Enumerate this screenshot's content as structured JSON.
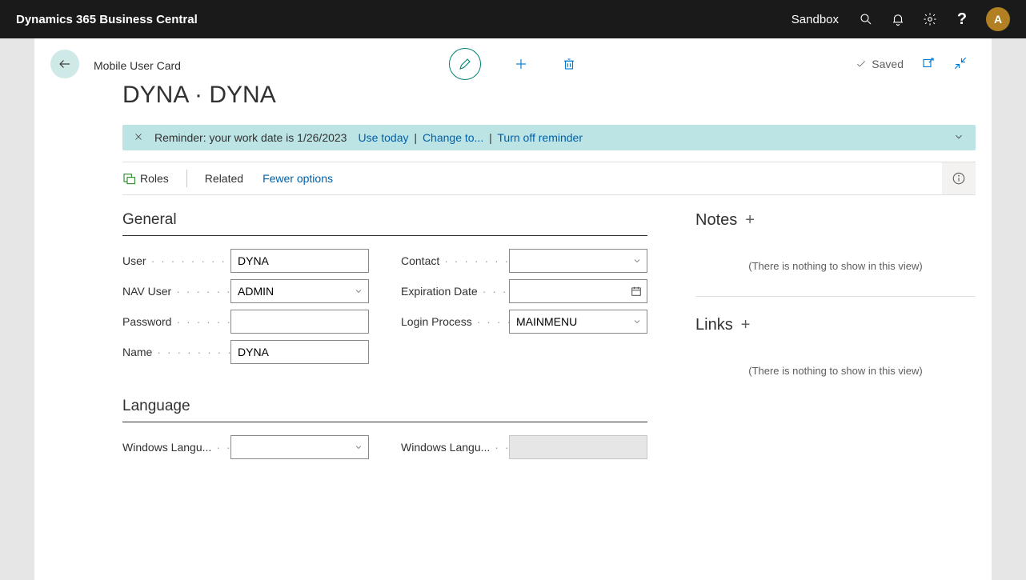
{
  "top": {
    "app_title": "Dynamics 365 Business Central",
    "env_label": "Sandbox",
    "avatar_letter": "A",
    "help_symbol": "?"
  },
  "header": {
    "page_label": "Mobile User Card",
    "title": "DYNA · DYNA",
    "saved_label": "Saved"
  },
  "notification": {
    "text": "Reminder: your work date is 1/26/2023",
    "use_today": "Use today",
    "change_to": "Change to...",
    "turn_off": "Turn off reminder"
  },
  "actions": {
    "roles": "Roles",
    "related": "Related",
    "fewer": "Fewer options"
  },
  "sections": {
    "general": "General",
    "language": "Language"
  },
  "fields": {
    "user_label": "User",
    "user_value": "DYNA",
    "nav_user_label": "NAV User",
    "nav_user_value": "ADMIN",
    "password_label": "Password",
    "password_value": "",
    "name_label": "Name",
    "name_value": "DYNA",
    "contact_label": "Contact",
    "contact_value": "",
    "expiration_label": "Expiration Date",
    "expiration_value": "",
    "login_process_label": "Login Process",
    "login_process_value": "MAINMENU",
    "win_lang_id_label": "Windows Langu...",
    "win_lang_id_value": "",
    "win_lang_name_label": "Windows Langu...",
    "win_lang_name_value": ""
  },
  "factbox": {
    "notes_title": "Notes",
    "links_title": "Links",
    "empty_msg": "(There is nothing to show in this view)"
  }
}
